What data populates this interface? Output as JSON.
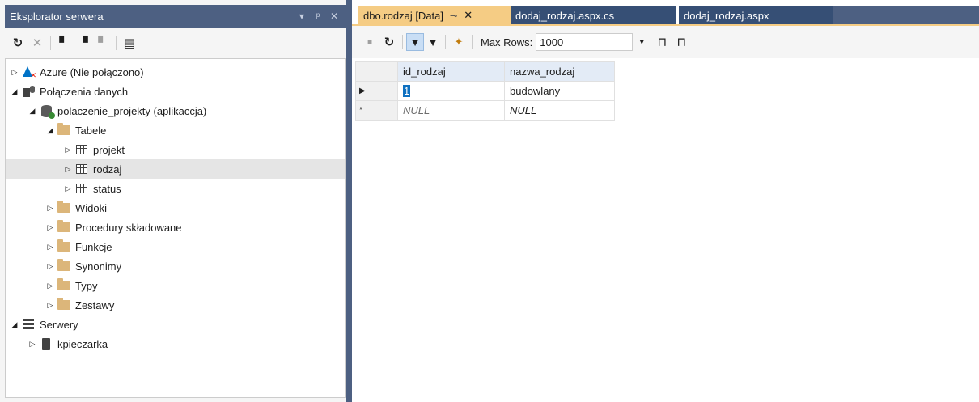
{
  "explorer": {
    "title": "Eksplorator serwera",
    "tree": [
      {
        "label": "Azure (Nie połączono)",
        "expanded": false,
        "icon": "azure-icon"
      },
      {
        "label": "Połączenia danych",
        "expanded": true,
        "icon": "data-connections-icon"
      },
      {
        "label": "polaczenie_projekty (aplikaccja)",
        "expanded": true,
        "icon": "database-icon"
      },
      {
        "label": "Tabele",
        "expanded": true,
        "icon": "folder-icon"
      },
      {
        "label": "projekt",
        "expanded": false,
        "icon": "table-icon"
      },
      {
        "label": "rodzaj",
        "expanded": false,
        "icon": "table-icon",
        "selected": true
      },
      {
        "label": "status",
        "expanded": false,
        "icon": "table-icon"
      },
      {
        "label": "Widoki",
        "expanded": false,
        "icon": "folder-icon"
      },
      {
        "label": "Procedury składowane",
        "expanded": false,
        "icon": "folder-icon"
      },
      {
        "label": "Funkcje",
        "expanded": false,
        "icon": "folder-icon"
      },
      {
        "label": "Synonimy",
        "expanded": false,
        "icon": "folder-icon"
      },
      {
        "label": "Typy",
        "expanded": false,
        "icon": "folder-icon"
      },
      {
        "label": "Zestawy",
        "expanded": false,
        "icon": "folder-icon"
      },
      {
        "label": "Serwery",
        "expanded": true,
        "icon": "servers-icon"
      },
      {
        "label": "kpieczarka",
        "expanded": false,
        "icon": "server-icon"
      }
    ]
  },
  "tabs": [
    {
      "label": "dbo.rodzaj [Data]",
      "active": true
    },
    {
      "label": "dodaj_rodzaj.aspx.cs",
      "active": false
    },
    {
      "label": "dodaj_rodzaj.aspx",
      "active": false
    }
  ],
  "toolbar": {
    "max_rows_label": "Max Rows:",
    "max_rows_value": "1000"
  },
  "grid": {
    "columns": [
      "id_rodzaj",
      "nazwa_rodzaj"
    ],
    "rows": [
      {
        "marker": "▶",
        "cells": [
          "1",
          "budowlany"
        ]
      },
      {
        "marker": "*",
        "cells": [
          "NULL",
          "NULL"
        ]
      }
    ]
  },
  "colors": {
    "title_bar": "#4d6082",
    "active_tab": "#f5cc84",
    "inactive_tab": "#364f75",
    "folder": "#dcb67a"
  }
}
